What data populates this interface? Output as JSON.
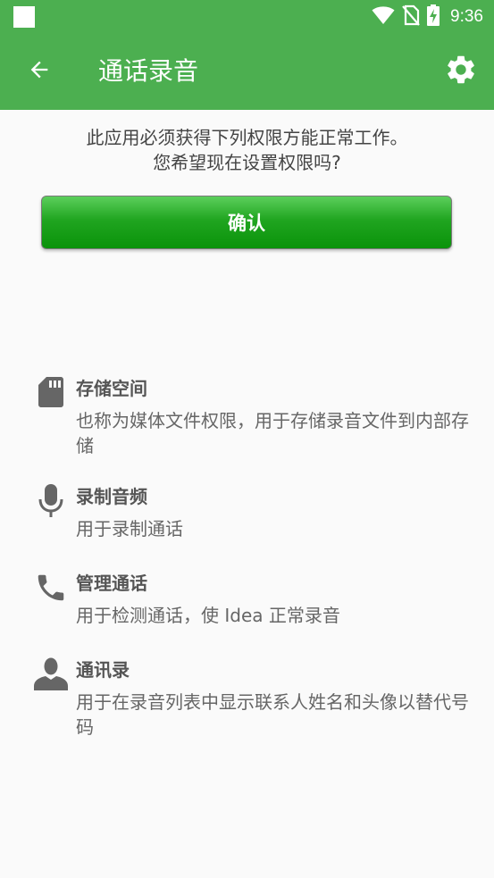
{
  "status_bar": {
    "time": "9:36",
    "background": "#4caf50"
  },
  "app_bar": {
    "title": "通话录音",
    "background": "#4caf50",
    "back_icon": "arrow-back-icon",
    "settings_icon": "gear-icon"
  },
  "prompt": {
    "line1": "此应用必须获得下列权限方能正常工作。",
    "line2": "您希望现在设置权限吗?"
  },
  "confirm_button": {
    "label": "确认",
    "color": "#0a930a"
  },
  "permissions": [
    {
      "icon": "sd-card-icon",
      "title": "存储空间",
      "description": "也称为媒体文件权限，用于存储录音文件到内部存储"
    },
    {
      "icon": "microphone-icon",
      "title": "录制音频",
      "description": "用于录制通话"
    },
    {
      "icon": "phone-icon",
      "title": "管理通话",
      "description": "用于检测通话，使 Idea 正常录音"
    },
    {
      "icon": "person-icon",
      "title": "通讯录",
      "description": "用于在录音列表中显示联系人姓名和头像以替代号码"
    }
  ]
}
